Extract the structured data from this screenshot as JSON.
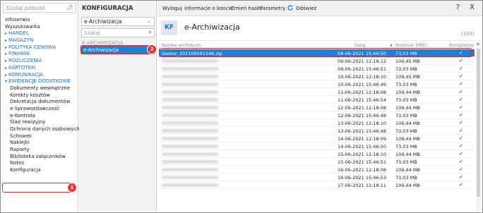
{
  "left_nav": {
    "search_placeholder": "Szukaj poleceń",
    "items": [
      {
        "label": "Infoserwis",
        "kind": "plain"
      },
      {
        "label": "Wyszukiwarka",
        "kind": "plain"
      },
      {
        "label": "HANDEL",
        "kind": "group"
      },
      {
        "label": "MAGAZYN",
        "kind": "group"
      },
      {
        "label": "POLITYKA CENOWA",
        "kind": "group"
      },
      {
        "label": "FINANSE",
        "kind": "group"
      },
      {
        "label": "ROZLICZENIA",
        "kind": "group"
      },
      {
        "label": "KARTOTEKI",
        "kind": "group"
      },
      {
        "label": "KOMUNIKACJA",
        "kind": "group"
      },
      {
        "label": "EWIDENCJE DODATKOWE",
        "kind": "group-open"
      },
      {
        "label": "Dokumenty wewnętrzne",
        "kind": "sub"
      },
      {
        "label": "Korekty kosztów",
        "kind": "sub"
      },
      {
        "label": "Dekretacja dokumentów",
        "kind": "sub"
      },
      {
        "label": "e-Sprawozdawczość",
        "kind": "sub"
      },
      {
        "label": "e-Kontrola",
        "kind": "sub"
      },
      {
        "label": "Ślad rewizyjny",
        "kind": "sub"
      },
      {
        "label": "Ochrona danych osobowych",
        "kind": "sub"
      },
      {
        "label": "Schowek",
        "kind": "sub"
      },
      {
        "label": "Naklejki",
        "kind": "sub"
      },
      {
        "label": "Raporty",
        "kind": "sub"
      },
      {
        "label": "Biblioteka załączników",
        "kind": "sub"
      },
      {
        "label": "Notes",
        "kind": "sub"
      },
      {
        "label": "Konfiguracja",
        "kind": "sub"
      }
    ],
    "badge": "1"
  },
  "config_panel": {
    "title": "KONFIGURACJA",
    "select_value": "e-Archiwizacja",
    "filter_placeholder": "Szukaj",
    "group_label": "E-ARCHIWIZACJA",
    "selected_item": "e-Archiwizacja",
    "badge": "2"
  },
  "toolbar": {
    "logout": "Wyloguj",
    "account_info": "Informacje o koncie",
    "change_password": "Zmień hasło",
    "parameters": "Parametry",
    "refresh": "Odśwież",
    "help": "?",
    "close": "X"
  },
  "header": {
    "logo": "KF",
    "title": "e-Archiwizacja",
    "count": "(103)"
  },
  "table": {
    "columns": {
      "name": "Nazwa archiwum",
      "date": "Data",
      "size": "Rozmiar [MB]",
      "complete": "Kompletne"
    },
    "sort_indicator": "▲",
    "rows": [
      {
        "name": "Gestor_202106081546.zip",
        "date": "08-06-2021 15:46:50",
        "size": "73,03 MB",
        "complete": "✓",
        "selected": true
      },
      {
        "name": "",
        "date": "09-06-2021 12:18:12",
        "size": "109,45 MB",
        "complete": "✓"
      },
      {
        "name": "",
        "date": "09-06-2021 15:46:51",
        "size": "73,03 MB",
        "complete": "✓"
      },
      {
        "name": "",
        "date": "10-06-2021 12:18:10",
        "size": "109,45 MB",
        "complete": "✓"
      },
      {
        "name": "",
        "date": "10-06-2021 15:46:49",
        "size": "73,03 MB",
        "complete": "✓"
      },
      {
        "name": "",
        "date": "11-06-2021 12:18:08",
        "size": "109,44 MB",
        "complete": "✓"
      },
      {
        "name": "",
        "date": "11-06-2021 15:46:54",
        "size": "73,03 MB",
        "complete": "✓"
      },
      {
        "name": "",
        "date": "12-06-2021 12:18:08",
        "size": "109,44 MB",
        "complete": "✓"
      },
      {
        "name": "",
        "date": "12-06-2021 15:46:48",
        "size": "73,03 MB",
        "complete": "✓"
      },
      {
        "name": "",
        "date": "13-06-2021 12:18:10",
        "size": "109,44 MB",
        "complete": "✓"
      },
      {
        "name": "",
        "date": "13-06-2021 15:46:48",
        "size": "73,03 MB",
        "complete": "✓"
      },
      {
        "name": "",
        "date": "14-06-2021 12:18:09",
        "size": "109,44 MB",
        "complete": "✓"
      },
      {
        "name": "",
        "date": "14-06-2021 15:46:50",
        "size": "73,03 MB",
        "complete": "✓"
      },
      {
        "name": "",
        "date": "15-06-2021 12:18:10",
        "size": "109,44 MB",
        "complete": "✓"
      },
      {
        "name": "",
        "date": "15-06-2021 15:46:51",
        "size": "73,03 MB",
        "complete": "✓"
      },
      {
        "name": "",
        "date": "16-06-2021 12:18:08",
        "size": "109,44 MB",
        "complete": "✓"
      },
      {
        "name": "",
        "date": "16-06-2021 15:46:53",
        "size": "73,03 MB",
        "complete": "✓"
      },
      {
        "name": "",
        "date": "17-06-2021 12:18:11",
        "size": "109,44 MB",
        "complete": "✓"
      }
    ]
  },
  "colors": {
    "accent": "#1f7fd0",
    "group_text": "#1f6fc5",
    "highlight_red": "#d32f2f"
  }
}
